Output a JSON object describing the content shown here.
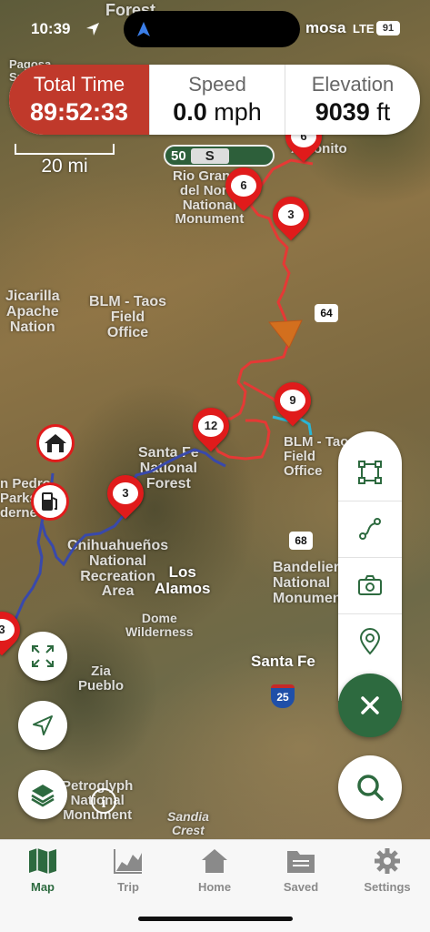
{
  "status_bar": {
    "time": "10:39",
    "network": "LTE",
    "battery": "91"
  },
  "stats": [
    {
      "label": "Total Time",
      "value": "89:52:33",
      "unit": ""
    },
    {
      "label": "Speed",
      "value": "0.0",
      "unit": "mph"
    },
    {
      "label": "Elevation",
      "value": "9039",
      "unit": "ft"
    }
  ],
  "scale": {
    "label": "20 mi"
  },
  "highway_shield": {
    "number": "50",
    "letter": "S"
  },
  "map_labels": {
    "forest_top": "Forest",
    "mosa": "mosa",
    "pagosa": "Pagosa\nSprings",
    "rio_grande": "Rio Grande\ndel Norte\nNational\nMonument",
    "antonito": "Antonito",
    "jicarilla": "Jicarilla\nApache\nNation",
    "blm_taos": "BLM - Taos\nField\nOffice",
    "route_64": "64",
    "santa_fe_nf": "Santa Fe\nNational\nForest",
    "blm_right": "BLM - Taos\nField\nOffice",
    "san_pedro": "n Pedro\nParks\nderness",
    "chihuahueños": "Chihuahueños\nNational\nRecreation\nArea",
    "route_68": "68",
    "los_alamos": "Los\nAlamos",
    "bandelier": "Bandelier\nNational\nMonument",
    "dome": "Dome\nWilderness",
    "zia": "Zia\nPueblo",
    "santa_fe": "Santa Fe",
    "route_25": "25",
    "petroglyph": "Petroglyph\nNational\nMonument",
    "sandia": "Sandia\nCrest"
  },
  "pins": [
    "6",
    "6",
    "3",
    "9",
    "12",
    "3",
    "3"
  ],
  "colors": {
    "accent_green": "#2d6a3f",
    "pin_red": "#e01b1b",
    "total_time_red": "#c0392b",
    "route_red": "#e53935",
    "route_blue": "#3949ab",
    "route_cyan": "#29b6d6"
  },
  "tabs": [
    {
      "label": "Map",
      "icon": "map-icon",
      "active": true
    },
    {
      "label": "Trip",
      "icon": "chart-icon",
      "active": false
    },
    {
      "label": "Home",
      "icon": "home-icon",
      "active": false
    },
    {
      "label": "Saved",
      "icon": "folder-icon",
      "active": false
    },
    {
      "label": "Settings",
      "icon": "gear-icon",
      "active": false
    }
  ]
}
